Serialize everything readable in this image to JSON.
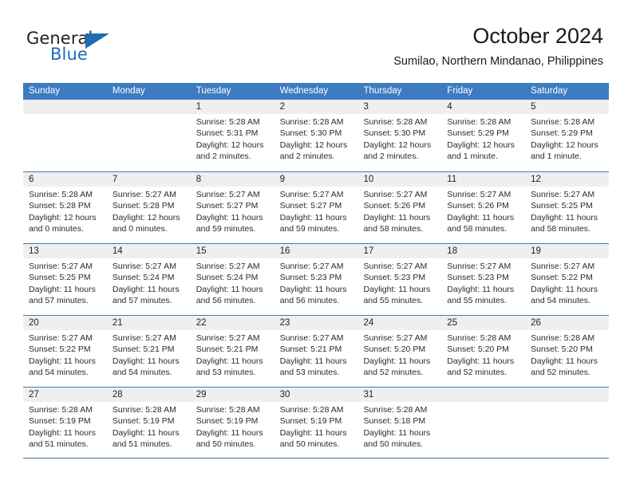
{
  "brand": {
    "name_part1": "General",
    "name_part2": "Blue",
    "accent_color": "#1e6cb5",
    "logo_icon": "triangle-flag-icon"
  },
  "header": {
    "title": "October 2024",
    "subtitle": "Sumilao, Northern Mindanao, Philippines"
  },
  "calendar": {
    "header_bg_color": "#3d7cc0",
    "row_border_color": "#4878b0",
    "date_band_color": "#efefef",
    "weekdays": [
      "Sunday",
      "Monday",
      "Tuesday",
      "Wednesday",
      "Thursday",
      "Friday",
      "Saturday"
    ],
    "weeks": [
      [
        {
          "day": "",
          "empty": true
        },
        {
          "day": "",
          "empty": true
        },
        {
          "day": "1",
          "sunrise": "Sunrise: 5:28 AM",
          "sunset": "Sunset: 5:31 PM",
          "daylight": "Daylight: 12 hours and 2 minutes."
        },
        {
          "day": "2",
          "sunrise": "Sunrise: 5:28 AM",
          "sunset": "Sunset: 5:30 PM",
          "daylight": "Daylight: 12 hours and 2 minutes."
        },
        {
          "day": "3",
          "sunrise": "Sunrise: 5:28 AM",
          "sunset": "Sunset: 5:30 PM",
          "daylight": "Daylight: 12 hours and 2 minutes."
        },
        {
          "day": "4",
          "sunrise": "Sunrise: 5:28 AM",
          "sunset": "Sunset: 5:29 PM",
          "daylight": "Daylight: 12 hours and 1 minute."
        },
        {
          "day": "5",
          "sunrise": "Sunrise: 5:28 AM",
          "sunset": "Sunset: 5:29 PM",
          "daylight": "Daylight: 12 hours and 1 minute."
        }
      ],
      [
        {
          "day": "6",
          "sunrise": "Sunrise: 5:28 AM",
          "sunset": "Sunset: 5:28 PM",
          "daylight": "Daylight: 12 hours and 0 minutes."
        },
        {
          "day": "7",
          "sunrise": "Sunrise: 5:27 AM",
          "sunset": "Sunset: 5:28 PM",
          "daylight": "Daylight: 12 hours and 0 minutes."
        },
        {
          "day": "8",
          "sunrise": "Sunrise: 5:27 AM",
          "sunset": "Sunset: 5:27 PM",
          "daylight": "Daylight: 11 hours and 59 minutes."
        },
        {
          "day": "9",
          "sunrise": "Sunrise: 5:27 AM",
          "sunset": "Sunset: 5:27 PM",
          "daylight": "Daylight: 11 hours and 59 minutes."
        },
        {
          "day": "10",
          "sunrise": "Sunrise: 5:27 AM",
          "sunset": "Sunset: 5:26 PM",
          "daylight": "Daylight: 11 hours and 58 minutes."
        },
        {
          "day": "11",
          "sunrise": "Sunrise: 5:27 AM",
          "sunset": "Sunset: 5:26 PM",
          "daylight": "Daylight: 11 hours and 58 minutes."
        },
        {
          "day": "12",
          "sunrise": "Sunrise: 5:27 AM",
          "sunset": "Sunset: 5:25 PM",
          "daylight": "Daylight: 11 hours and 58 minutes."
        }
      ],
      [
        {
          "day": "13",
          "sunrise": "Sunrise: 5:27 AM",
          "sunset": "Sunset: 5:25 PM",
          "daylight": "Daylight: 11 hours and 57 minutes."
        },
        {
          "day": "14",
          "sunrise": "Sunrise: 5:27 AM",
          "sunset": "Sunset: 5:24 PM",
          "daylight": "Daylight: 11 hours and 57 minutes."
        },
        {
          "day": "15",
          "sunrise": "Sunrise: 5:27 AM",
          "sunset": "Sunset: 5:24 PM",
          "daylight": "Daylight: 11 hours and 56 minutes."
        },
        {
          "day": "16",
          "sunrise": "Sunrise: 5:27 AM",
          "sunset": "Sunset: 5:23 PM",
          "daylight": "Daylight: 11 hours and 56 minutes."
        },
        {
          "day": "17",
          "sunrise": "Sunrise: 5:27 AM",
          "sunset": "Sunset: 5:23 PM",
          "daylight": "Daylight: 11 hours and 55 minutes."
        },
        {
          "day": "18",
          "sunrise": "Sunrise: 5:27 AM",
          "sunset": "Sunset: 5:23 PM",
          "daylight": "Daylight: 11 hours and 55 minutes."
        },
        {
          "day": "19",
          "sunrise": "Sunrise: 5:27 AM",
          "sunset": "Sunset: 5:22 PM",
          "daylight": "Daylight: 11 hours and 54 minutes."
        }
      ],
      [
        {
          "day": "20",
          "sunrise": "Sunrise: 5:27 AM",
          "sunset": "Sunset: 5:22 PM",
          "daylight": "Daylight: 11 hours and 54 minutes."
        },
        {
          "day": "21",
          "sunrise": "Sunrise: 5:27 AM",
          "sunset": "Sunset: 5:21 PM",
          "daylight": "Daylight: 11 hours and 54 minutes."
        },
        {
          "day": "22",
          "sunrise": "Sunrise: 5:27 AM",
          "sunset": "Sunset: 5:21 PM",
          "daylight": "Daylight: 11 hours and 53 minutes."
        },
        {
          "day": "23",
          "sunrise": "Sunrise: 5:27 AM",
          "sunset": "Sunset: 5:21 PM",
          "daylight": "Daylight: 11 hours and 53 minutes."
        },
        {
          "day": "24",
          "sunrise": "Sunrise: 5:27 AM",
          "sunset": "Sunset: 5:20 PM",
          "daylight": "Daylight: 11 hours and 52 minutes."
        },
        {
          "day": "25",
          "sunrise": "Sunrise: 5:28 AM",
          "sunset": "Sunset: 5:20 PM",
          "daylight": "Daylight: 11 hours and 52 minutes."
        },
        {
          "day": "26",
          "sunrise": "Sunrise: 5:28 AM",
          "sunset": "Sunset: 5:20 PM",
          "daylight": "Daylight: 11 hours and 52 minutes."
        }
      ],
      [
        {
          "day": "27",
          "sunrise": "Sunrise: 5:28 AM",
          "sunset": "Sunset: 5:19 PM",
          "daylight": "Daylight: 11 hours and 51 minutes."
        },
        {
          "day": "28",
          "sunrise": "Sunrise: 5:28 AM",
          "sunset": "Sunset: 5:19 PM",
          "daylight": "Daylight: 11 hours and 51 minutes."
        },
        {
          "day": "29",
          "sunrise": "Sunrise: 5:28 AM",
          "sunset": "Sunset: 5:19 PM",
          "daylight": "Daylight: 11 hours and 50 minutes."
        },
        {
          "day": "30",
          "sunrise": "Sunrise: 5:28 AM",
          "sunset": "Sunset: 5:19 PM",
          "daylight": "Daylight: 11 hours and 50 minutes."
        },
        {
          "day": "31",
          "sunrise": "Sunrise: 5:28 AM",
          "sunset": "Sunset: 5:18 PM",
          "daylight": "Daylight: 11 hours and 50 minutes."
        },
        {
          "day": "",
          "empty": true
        },
        {
          "day": "",
          "empty": true
        }
      ]
    ]
  }
}
